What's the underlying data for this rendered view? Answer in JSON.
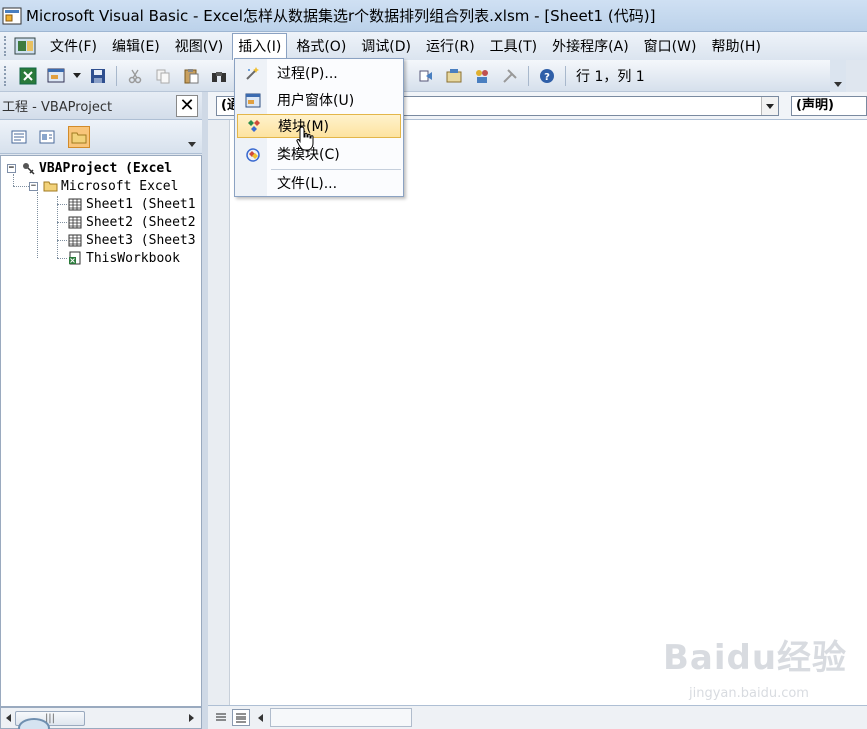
{
  "window": {
    "title": "Microsoft Visual Basic - Excel怎样从数据集选r个数据排列组合列表.xlsm - [Sheet1 (代码)]"
  },
  "menubar": {
    "items": [
      "文件(F)",
      "编辑(E)",
      "视图(V)",
      "插入(I)",
      "格式(O)",
      "调试(D)",
      "运行(R)",
      "工具(T)",
      "外接程序(A)",
      "窗口(W)",
      "帮助(H)"
    ],
    "active_index": 3
  },
  "toolbar": {
    "position_text": "行 1，列 1"
  },
  "insert_menu": {
    "items": [
      {
        "label": "过程(P)...",
        "icon": "procedure-icon"
      },
      {
        "label": "用户窗体(U)",
        "icon": "userform-icon"
      },
      {
        "label": "模块(M)",
        "icon": "module-icon",
        "highlighted": true
      },
      {
        "label": "类模块(C)",
        "icon": "class-module-icon"
      },
      {
        "label": "文件(L)...",
        "icon": "none"
      }
    ],
    "highlight_color": "#fde3a0"
  },
  "project_panel": {
    "title": "工程 - VBAProject",
    "close_label": "✕",
    "tree": [
      {
        "label": "VBAProject (Excel",
        "level": 0,
        "bold": true,
        "expander": "−",
        "icon": "vbaproject-icon"
      },
      {
        "label": "Microsoft Excel ",
        "level": 1,
        "bold": false,
        "expander": "−",
        "icon": "folder-icon"
      },
      {
        "label": "Sheet1 (Sheet1",
        "level": 2,
        "bold": false,
        "expander": "",
        "icon": "sheet-icon"
      },
      {
        "label": "Sheet2 (Sheet2",
        "level": 2,
        "bold": false,
        "expander": "",
        "icon": "sheet-icon"
      },
      {
        "label": "Sheet3 (Sheet3",
        "level": 2,
        "bold": false,
        "expander": "",
        "icon": "sheet-icon"
      },
      {
        "label": "ThisWorkbook",
        "level": 2,
        "bold": false,
        "expander": "",
        "icon": "workbook-icon"
      }
    ]
  },
  "code_window": {
    "object_combo": "(通用)",
    "procedure_combo": "(声明)"
  },
  "watermark": {
    "logo": "Baidu经验",
    "url": "jingyan.baidu.com"
  }
}
